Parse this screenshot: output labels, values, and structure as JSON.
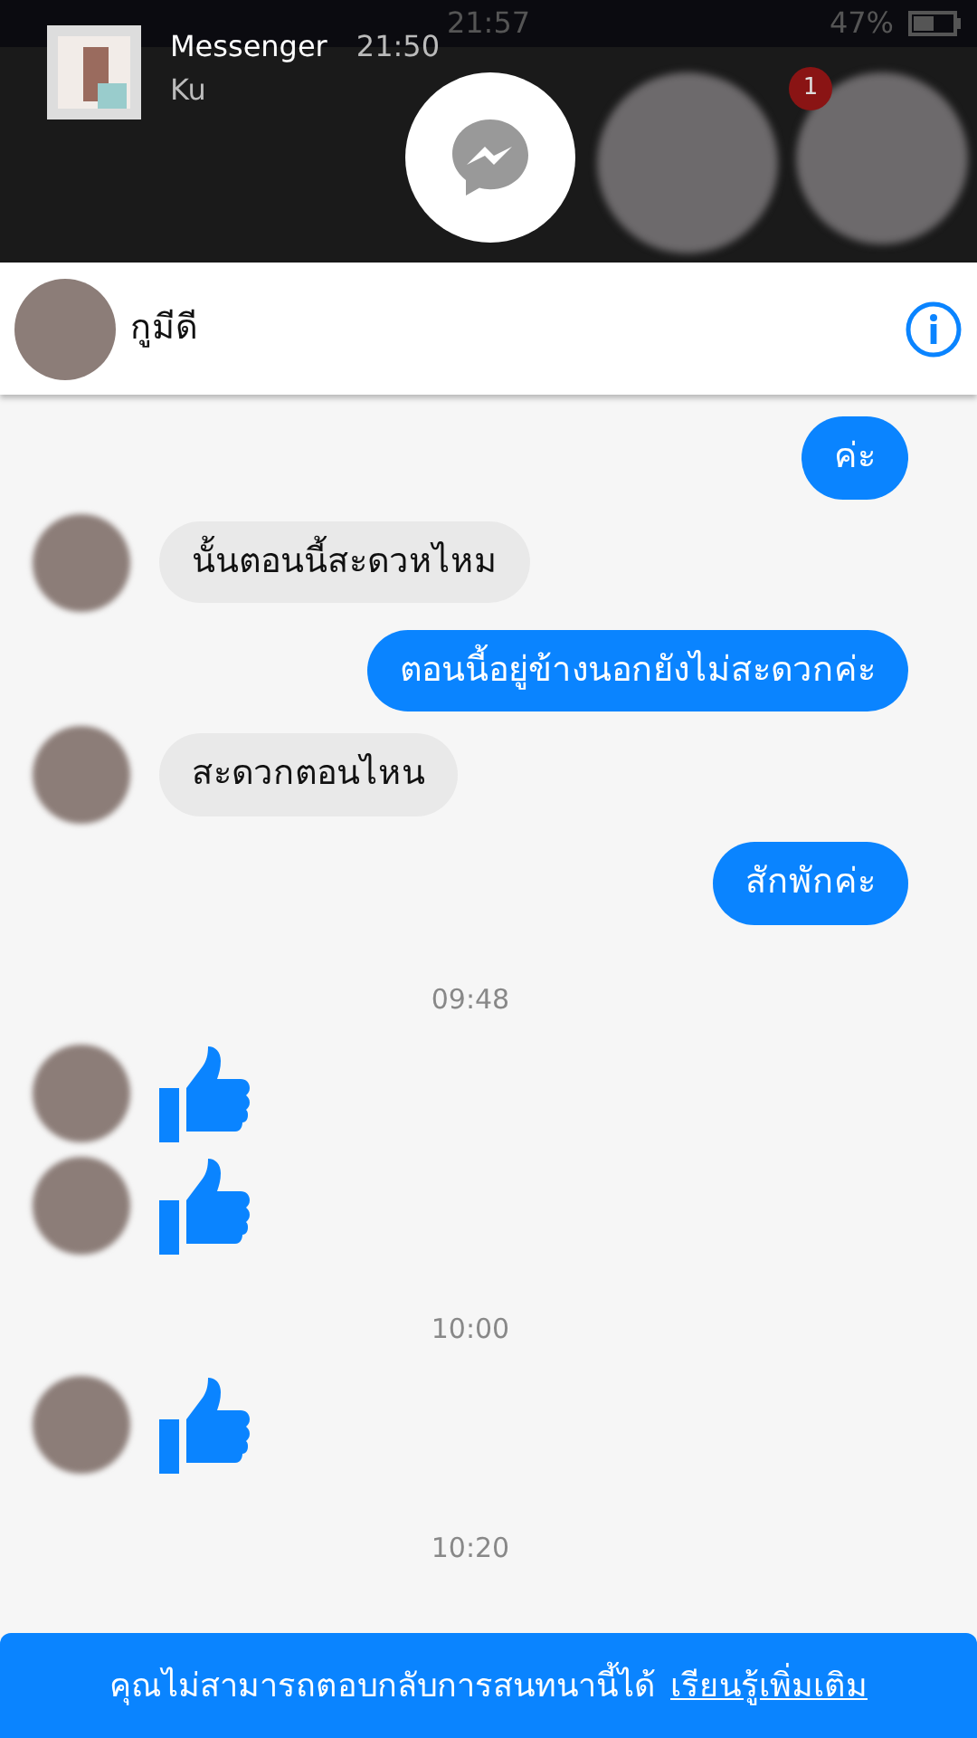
{
  "status_bar": {
    "time": "21:57",
    "battery_text": "47%"
  },
  "notification": {
    "app": "Messenger",
    "time": "21:50",
    "preview": "Ku"
  },
  "chat_heads": [
    {
      "badge": "1"
    }
  ],
  "header": {
    "name": "กูมีดี"
  },
  "messages": [
    {
      "kind": "sent",
      "text": "ค่ะ"
    },
    {
      "kind": "received",
      "text": "นั้นตอนนี้สะดวหไหม"
    },
    {
      "kind": "sent",
      "text": "ตอนนี้อยู่ข้างนอกยังไม่สะดวกค่ะ"
    },
    {
      "kind": "received",
      "text": "สะดวกตอนไหน"
    },
    {
      "kind": "sent",
      "text": "สักพักค่ะ"
    },
    {
      "kind": "time",
      "text": "09:48"
    },
    {
      "kind": "like"
    },
    {
      "kind": "like"
    },
    {
      "kind": "time",
      "text": "10:00"
    },
    {
      "kind": "like"
    },
    {
      "kind": "time",
      "text": "10:20"
    }
  ],
  "footer": {
    "text": "คุณไม่สามารถตอบกลับการสนทนานี้ได้",
    "link": "เรียนรู้เพิ่มเติม"
  }
}
